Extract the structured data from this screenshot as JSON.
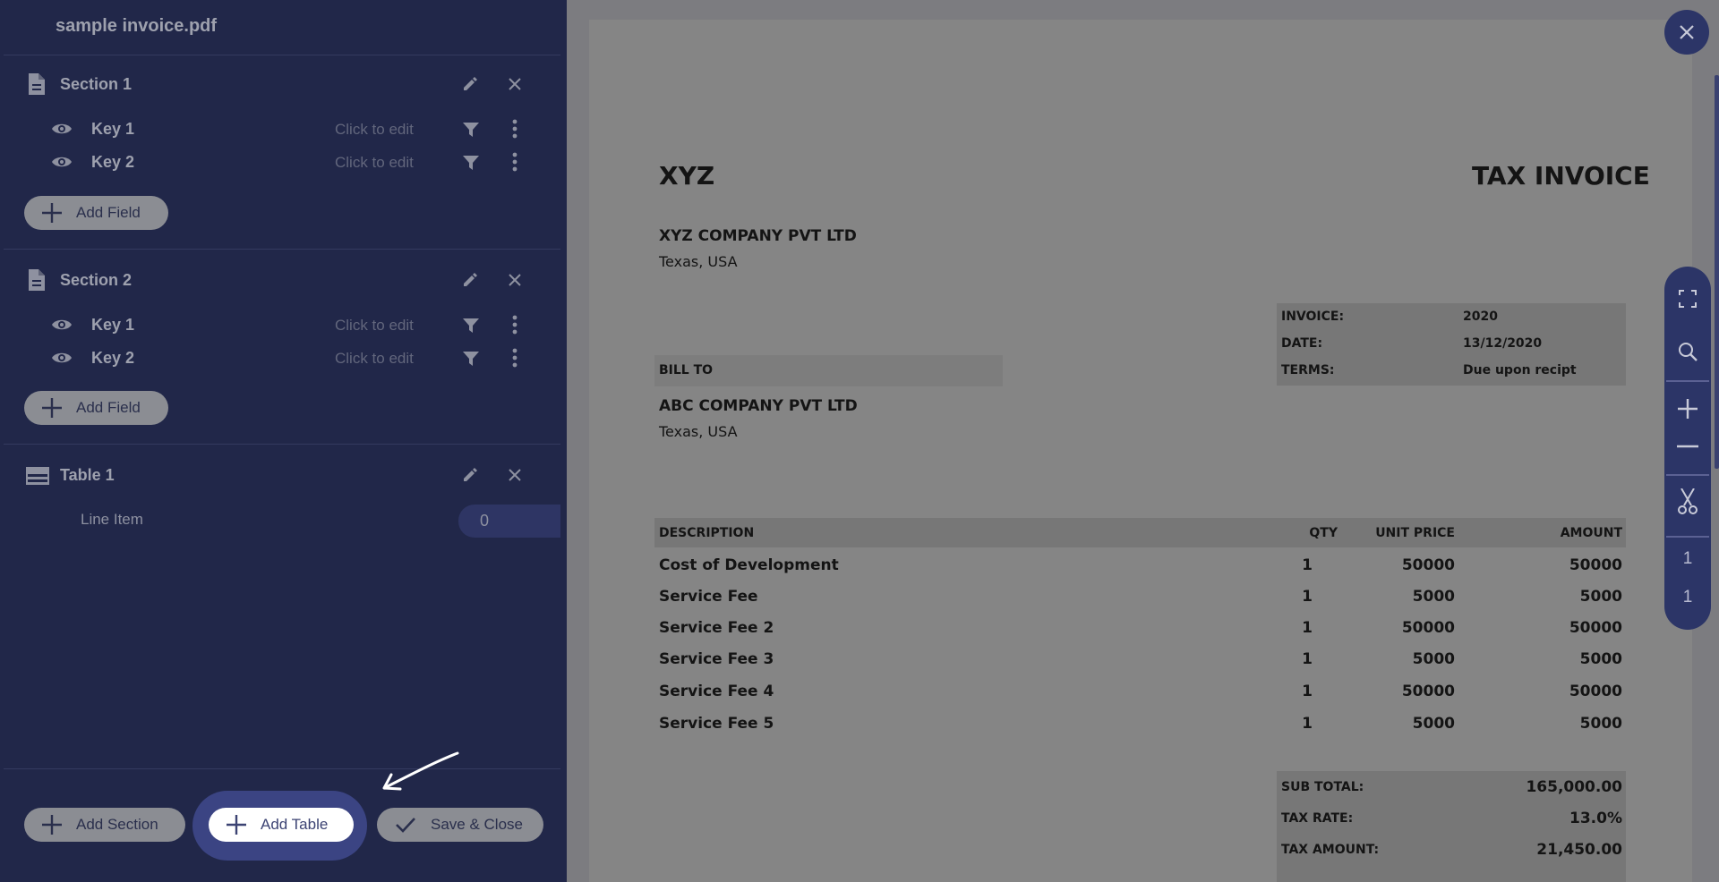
{
  "panel": {
    "filename": "sample invoice.pdf",
    "sections": [
      {
        "title": "Section 1",
        "fields": [
          {
            "key": "Key 1",
            "value_placeholder": "Click to edit"
          },
          {
            "key": "Key 2",
            "value_placeholder": "Click to edit"
          }
        ],
        "add_field_label": "Add Field"
      },
      {
        "title": "Section 2",
        "fields": [
          {
            "key": "Key 1",
            "value_placeholder": "Click to edit"
          },
          {
            "key": "Key 2",
            "value_placeholder": "Click to edit"
          }
        ],
        "add_field_label": "Add Field"
      }
    ],
    "table": {
      "title": "Table 1",
      "row_label": "Line Item",
      "row_count": "0"
    },
    "footer": {
      "add_section": "Add Section",
      "add_table": "Add Table",
      "save_close": "Save & Close"
    }
  },
  "invoice": {
    "company_short": "XYZ",
    "doc_title": "TAX INVOICE",
    "company_name": "XYZ COMPANY PVT LTD",
    "company_location": "Texas, USA",
    "meta": [
      {
        "label": "INVOICE:",
        "value": "2020"
      },
      {
        "label": "DATE:",
        "value": "13/12/2020"
      },
      {
        "label": "TERMS:",
        "value": "Due upon recipt"
      }
    ],
    "bill_to_label": "BILL TO",
    "client_name": "ABC COMPANY PVT LTD",
    "client_location": "Texas, USA",
    "table_headers": {
      "description": "DESCRIPTION",
      "qty": "QTY",
      "unit_price": "UNIT PRICE",
      "amount": "AMOUNT"
    },
    "items": [
      {
        "description": "Cost of Development",
        "qty": "1",
        "unit_price": "50000",
        "amount": "50000"
      },
      {
        "description": "Service Fee",
        "qty": "1",
        "unit_price": "5000",
        "amount": "5000"
      },
      {
        "description": "Service Fee 2",
        "qty": "1",
        "unit_price": "50000",
        "amount": "50000"
      },
      {
        "description": "Service Fee 3",
        "qty": "1",
        "unit_price": "5000",
        "amount": "5000"
      },
      {
        "description": "Service Fee 4",
        "qty": "1",
        "unit_price": "50000",
        "amount": "50000"
      },
      {
        "description": "Service Fee 5",
        "qty": "1",
        "unit_price": "5000",
        "amount": "5000"
      }
    ],
    "totals": [
      {
        "label": "SUB TOTAL:",
        "value": "165,000.00"
      },
      {
        "label": "TAX RATE:",
        "value": "13.0%"
      },
      {
        "label": "TAX AMOUNT:",
        "value": "21,450.00"
      }
    ]
  },
  "toolbar": {
    "page_current": "1",
    "page_total": "1"
  },
  "icons": [
    "document-icon",
    "pencil-icon",
    "close-icon",
    "eye-icon",
    "filter-icon",
    "more-vertical-icon",
    "plus-icon",
    "table-icon",
    "check-icon",
    "fullscreen-icon",
    "search-icon",
    "zoom-in-icon",
    "zoom-out-icon",
    "scissors-icon",
    "arrow-annotation"
  ],
  "colors": {
    "panel_bg": "#212749",
    "accent": "#2c3567",
    "highlight": "#3b4483"
  }
}
